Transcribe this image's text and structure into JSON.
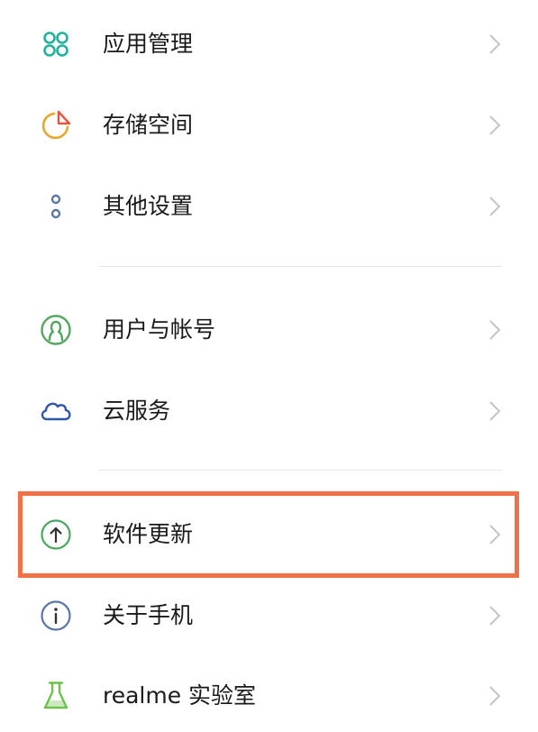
{
  "colors": {
    "highlight": "#f07048",
    "chevron": "#c4c4c4",
    "divider": "#e3e3e3",
    "text": "#1a1a1a"
  },
  "settings": {
    "items": [
      {
        "label": "应用管理",
        "icon": "app-management-icon",
        "color": "#1fb39a"
      },
      {
        "label": "存储空间",
        "icon": "storage-pie-icon",
        "color": "#e9a628"
      },
      {
        "label": "其他设置",
        "icon": "more-settings-dots-icon",
        "color": "#5877a8"
      },
      {
        "label": "用户与帐号",
        "icon": "user-account-icon",
        "color": "#52a860"
      },
      {
        "label": "云服务",
        "icon": "cloud-icon",
        "color": "#2c56a8"
      },
      {
        "label": "软件更新",
        "icon": "upload-arrow-icon",
        "color": "#4aa85f",
        "highlighted": true
      },
      {
        "label": "关于手机",
        "icon": "info-icon",
        "color": "#5877a8"
      },
      {
        "label": "realme 实验室",
        "icon": "flask-icon",
        "color": "#6cc24a"
      }
    ]
  }
}
